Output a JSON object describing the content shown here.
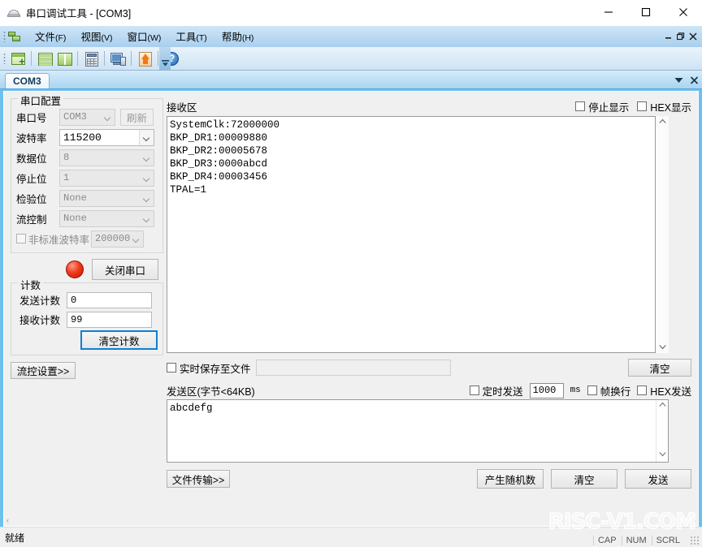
{
  "window": {
    "title": "串口调试工具 - [COM3]",
    "icon": "serial-tool-icon",
    "minimize": "–",
    "maximize": "□",
    "close": "✕"
  },
  "menubar": {
    "items": [
      {
        "label": "文件",
        "mnemonic": "(F)"
      },
      {
        "label": "视图",
        "mnemonic": "(V)"
      },
      {
        "label": "窗口",
        "mnemonic": "(W)"
      },
      {
        "label": "工具",
        "mnemonic": "(T)"
      },
      {
        "label": "帮助",
        "mnemonic": "(H)"
      }
    ],
    "mdi_minimize": "–",
    "mdi_restore": "❐",
    "mdi_close": "✕"
  },
  "toolbar": {
    "icons": [
      "new-window-icon",
      "tile-horizontal-icon",
      "tile-vertical-icon",
      "calculator-icon",
      "monitor-icon",
      "upload-icon",
      "help-icon"
    ],
    "overflow": "▼"
  },
  "tabs": {
    "items": [
      {
        "label": "COM3",
        "active": true
      }
    ],
    "dropdown": "▼",
    "close": "✕"
  },
  "serial_config": {
    "legend": "串口配置",
    "fields": [
      {
        "label": "串口号",
        "value": "COM3",
        "enabled": false
      },
      {
        "label": "波特率",
        "value": "115200",
        "enabled": true
      },
      {
        "label": "数据位",
        "value": "8",
        "enabled": false
      },
      {
        "label": "停止位",
        "value": "1",
        "enabled": false
      },
      {
        "label": "检验位",
        "value": "None",
        "enabled": false
      },
      {
        "label": "流控制",
        "value": "None",
        "enabled": false
      }
    ],
    "refresh_button": "刷新",
    "nonstandard": {
      "label": "非标准波特率",
      "value": "200000",
      "checked": false
    },
    "port_button": "关闭串口",
    "led_color": "#f03a1c"
  },
  "counters": {
    "legend": "计数",
    "send_label": "发送计数",
    "send_value": "0",
    "recv_label": "接收计数",
    "recv_value": "99",
    "clear_button": "清空计数",
    "focus_color": "#0f7fd4"
  },
  "flow_settings_button": "流控设置>>",
  "receive": {
    "title": "接收区",
    "stop_display": "停止显示",
    "hex_display": "HEX显示",
    "stop_checked": false,
    "hex_checked": false,
    "lines": [
      "SystemClk:72000000",
      "BKP_DR1:00009880",
      "BKP_DR2:00005678",
      "BKP_DR3:0000abcd",
      "BKP_DR4:00003456",
      "TPAL=1"
    ],
    "save_to_file_label": "实时保存至文件",
    "save_to_file_checked": false,
    "save_path": "",
    "clear_button": "清空",
    "scroll_up": "▲",
    "scroll_down": "▼"
  },
  "send": {
    "title": "发送区(字节<64KB)",
    "timed_send_label": "定时发送",
    "timed_send_checked": false,
    "interval_value": "1000",
    "interval_unit": "ms",
    "frame_newline_label": "帧换行",
    "frame_newline_checked": false,
    "hex_send_label": "HEX发送",
    "hex_send_checked": false,
    "text": "abcdefg",
    "file_transfer_button": "文件传输>>",
    "random_button": "产生随机数",
    "clear_button": "清空",
    "send_button": "发送",
    "scroll_up": "▲",
    "scroll_down": "▼"
  },
  "bottom_scroll": {
    "left_arrow": "‹",
    "right_arrow": "›"
  },
  "statusbar": {
    "text": "就绪",
    "indicators": [
      "CAP",
      "NUM",
      "SCRL"
    ]
  },
  "watermark": "RISC-V1.COM"
}
